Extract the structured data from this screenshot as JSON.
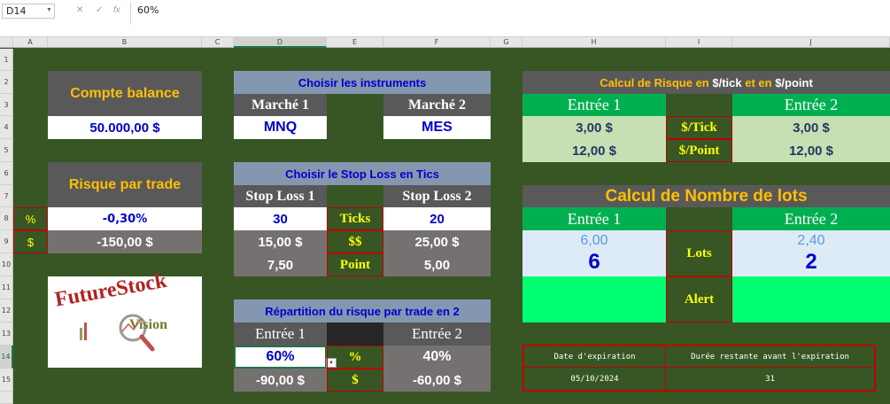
{
  "formula_bar": {
    "cell_ref": "D14",
    "value": "60%",
    "fx_icons": [
      "✕",
      "✓",
      "fx"
    ]
  },
  "columns": [
    "A",
    "B",
    "C",
    "D",
    "E",
    "F",
    "G",
    "H",
    "I",
    "J"
  ],
  "rows": [
    "1",
    "2",
    "3",
    "4",
    "5",
    "6",
    "7",
    "8",
    "9",
    "10",
    "11",
    "12",
    "13",
    "14",
    "15"
  ],
  "balance": {
    "title": "Compte balance",
    "value": "50.000,00 $"
  },
  "risk_trade": {
    "title": "Risque par trade",
    "pct_label": "%",
    "pct_value": "-0,30%",
    "usd_label": "$",
    "usd_value": "-150,00 $"
  },
  "logo": {
    "line1": "FutureStock",
    "line2": "Vision"
  },
  "instruments": {
    "title": "Choisir les instruments",
    "market1_label": "Marché 1",
    "market2_label": "Marché 2",
    "market1_value": "MNQ",
    "market2_value": "MES"
  },
  "stoploss": {
    "title": "Choisir le Stop Loss en Tics",
    "sl1_label": "Stop Loss 1",
    "sl2_label": "Stop Loss 2",
    "sl1_ticks": "30",
    "sl2_ticks": "20",
    "ticks_label": "Ticks",
    "sl1_usd": "15,00 $",
    "sl2_usd": "25,00 $",
    "usd_label": "$$",
    "sl1_point": "7,50",
    "sl2_point": "5,00",
    "point_label": "Point"
  },
  "repartition": {
    "title": "Répartition du risque par trade en 2",
    "e1_label": "Entrée 1",
    "e2_label": "Entrée 2",
    "e1_pct": "60%",
    "e2_pct": "40%",
    "pct_label": "%",
    "e1_usd": "-90,00 $",
    "e2_usd": "-60,00 $",
    "usd_label": "$"
  },
  "calc_risk": {
    "title_pre": "Calcul de Risque en ",
    "title_unit1": "$/tick",
    "title_mid": " et en ",
    "title_unit2": "$/point",
    "e1_label": "Entrée 1",
    "e2_label": "Entrée 2",
    "e1_tick": "3,00 $",
    "e2_tick": "3,00 $",
    "tick_label": "$/Tick",
    "e1_point": "12,00 $",
    "e2_point": "12,00 $",
    "point_label": "$/Point"
  },
  "calc_lots": {
    "title": "Calcul de Nombre de lots",
    "e1_label": "Entrée 1",
    "e2_label": "Entrée 2",
    "e1_raw": "6,00",
    "e2_raw": "2,40",
    "e1_lots": "6",
    "e2_lots": "2",
    "lots_label": "Lots",
    "alert_label": "Alert"
  },
  "expiration": {
    "date_label": "Date d'expiration",
    "remaining_label": "Durée restante avant l'expiration",
    "date_value": "05/10/2024",
    "remaining_value": "31"
  },
  "colors": {
    "sheet_bg": "#375623",
    "header_gray": "#595959",
    "orange": "#ffc000",
    "value_gray": "#767171",
    "blue_header": "#8497b0",
    "green": "#00b050",
    "bright_green": "#00ff73",
    "pale_green": "#c6e0b4",
    "pale_blue": "#ddebf7",
    "red_border": "#c00000"
  }
}
